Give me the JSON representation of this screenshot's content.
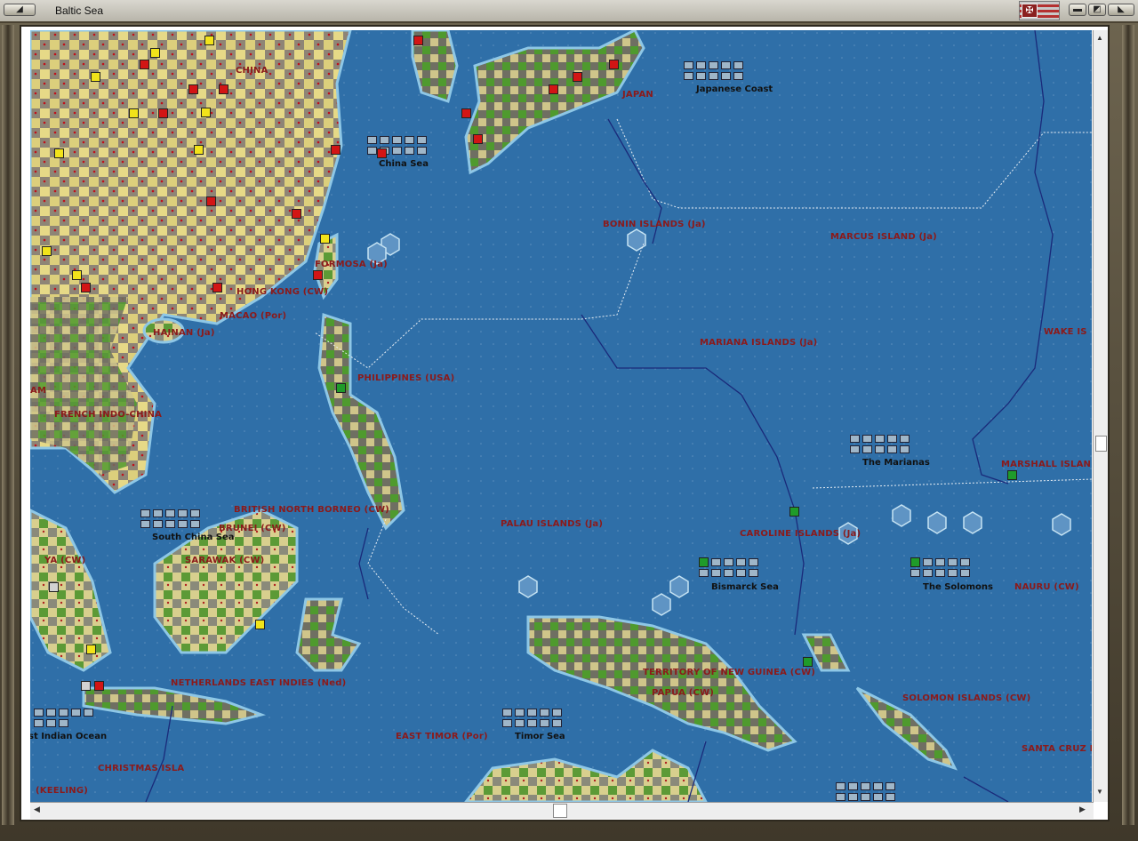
{
  "window": {
    "title": "Baltic Sea"
  },
  "colors": {
    "sea": "#2f6fa8",
    "label": "#8b1a1a",
    "china_unit": "#f2e31a",
    "japan_unit": "#d21515",
    "us_unit": "#1f9b2a"
  },
  "map": {
    "labels": [
      "CHINA",
      "JAPAN",
      "FORMOSA (Ja)",
      "HONG KONG (CW)",
      "MACAO (Por)",
      "HAINAN (Ja)",
      "FRENCH INDO-CHINA",
      "AM",
      "PHILIPPINES (USA)",
      "BONIN ISLANDS (Ja)",
      "MARCUS ISLAND (Ja)",
      "MARIANA ISLANDS (Ja)",
      "WAKE IS",
      "MARSHALL ISLAN",
      "BRITISH NORTH BORNEO (CW)",
      "BRUNEI (CW)",
      "SARAWAK (CW)",
      "YA (CW)",
      "PALAU ISLANDS (Ja)",
      "CAROLINE ISLANDS (Ja)",
      "NAURU (CW)",
      "TERRITORY OF NEW GUINEA (CW)",
      "PAPUA (CW)",
      "SOLOMON ISLANDS (CW)",
      "SANTA CRUZ I",
      "NETHERLANDS EAST INDIES (Ned)",
      "EAST TIMOR (Por)",
      "CHRISTMAS ISLA",
      "(KEELING)"
    ],
    "sea_zones": [
      "Japanese Coast",
      "China Sea",
      "The Marianas",
      "South China Sea",
      "Bismarck Sea",
      "The Solomons",
      "Timor Sea",
      "st Indian Ocean"
    ]
  },
  "scrollbars": {
    "up": "▲",
    "down": "▼",
    "left": "◀",
    "right": "▶"
  }
}
